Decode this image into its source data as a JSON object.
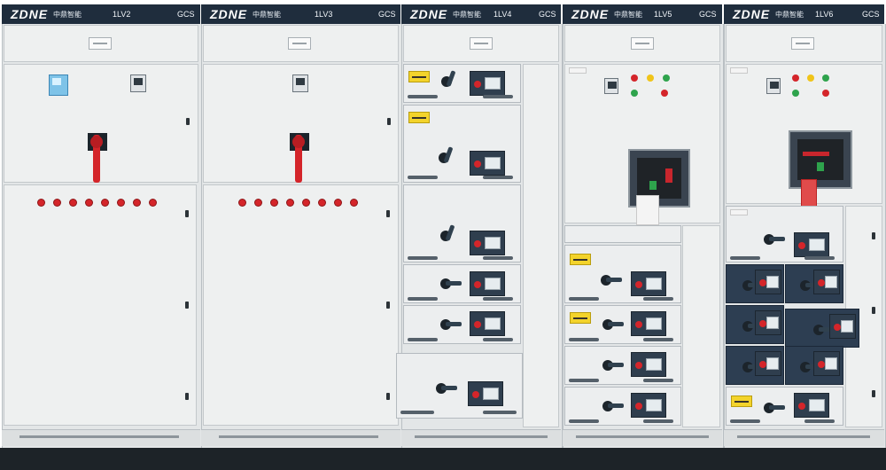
{
  "cabinets": [
    {
      "brand": "ZDNE",
      "brand_sub": "中鼎智能",
      "code": "1LV2",
      "type": "GCS"
    },
    {
      "brand": "ZDNE",
      "brand_sub": "中鼎智能",
      "code": "1LV3",
      "type": "GCS"
    },
    {
      "brand": "ZDNE",
      "brand_sub": "中鼎智能",
      "code": "1LV4",
      "type": "GCS"
    },
    {
      "brand": "ZDNE",
      "brand_sub": "中鼎智能",
      "code": "1LV5",
      "type": "GCS"
    },
    {
      "brand": "ZDNE",
      "brand_sub": "中鼎智能",
      "code": "1LV6",
      "type": "GCS"
    }
  ],
  "colors": {
    "header": "#1f2d3d",
    "panel": "#eef0f0",
    "handle_red": "#d4252a",
    "warning_yellow": "#f3d32b",
    "drawer_dark": "#2d3e52"
  },
  "icons": [
    "rotary-handle-icon",
    "indicator-lamp-icon",
    "digital-meter-icon",
    "air-circuit-breaker-icon"
  ]
}
